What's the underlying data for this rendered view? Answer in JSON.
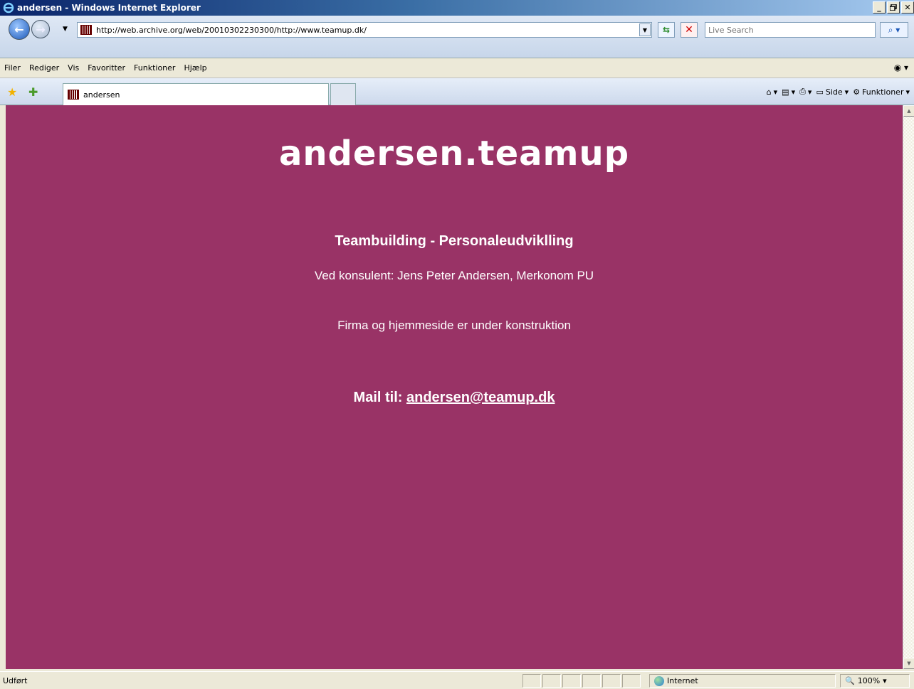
{
  "window": {
    "title": "andersen - Windows Internet Explorer",
    "minimize_label": "_",
    "maximize_label": "́",
    "close_label": "X"
  },
  "address": {
    "url": "http://web.archive.org/web/20010302230300/http://www.teamup.dk/",
    "search_placeholder": "Live Search"
  },
  "menu": {
    "items": [
      "Filer",
      "Rediger",
      "Vis",
      "Favoritter",
      "Funktioner",
      "Hjælp"
    ]
  },
  "tabs": {
    "active_label": "andersen"
  },
  "command_bar": {
    "side_label": "Side",
    "tools_label": "Funktioner"
  },
  "page": {
    "site_title": "andersen.teamup",
    "subtitle": "Teambuilding - Personaleudviklling",
    "consultant": "Ved konsulent: Jens Peter Andersen, Merkonom PU",
    "construction": "Firma og hjemmeside er under konstruktion",
    "mail_prefix": "Mail til: ",
    "mail_address": "andersen@teamup.dk",
    "background_color": "#993366"
  },
  "status": {
    "text": "Udført",
    "zone": "Internet",
    "zoom": "100%"
  }
}
